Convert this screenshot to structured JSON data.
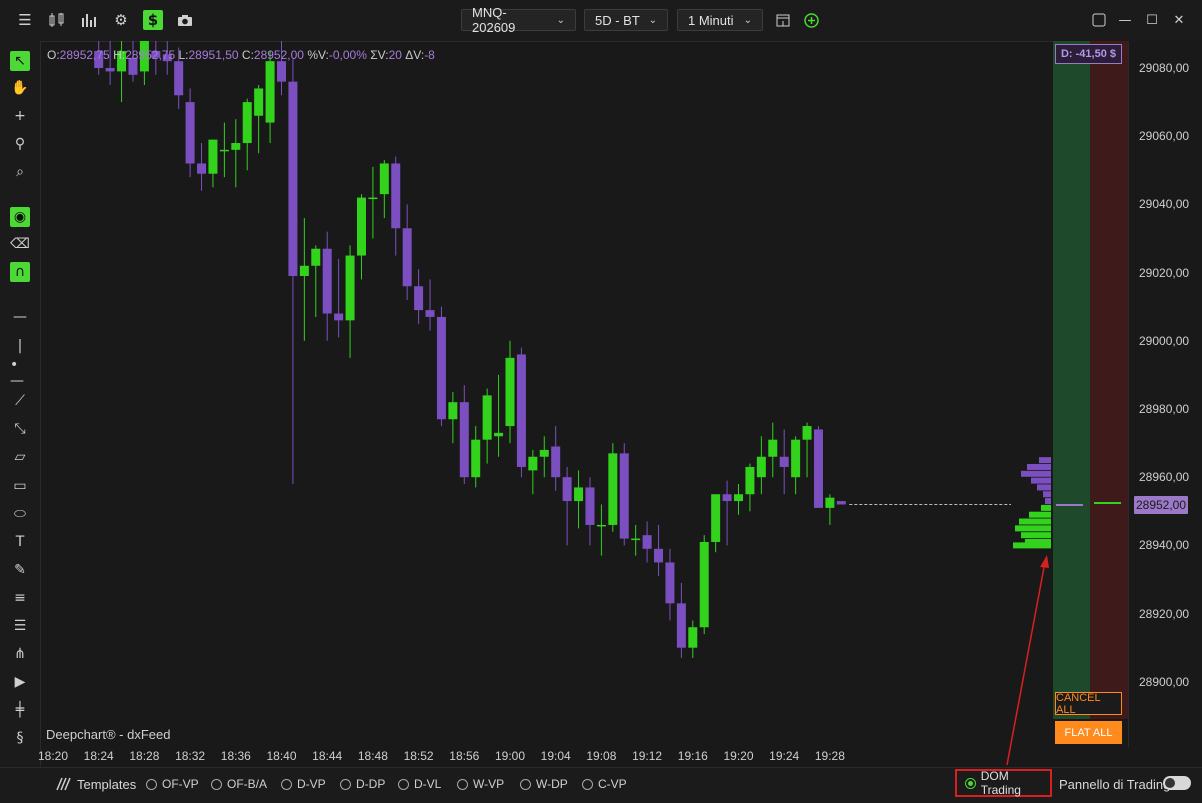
{
  "toolbar": {
    "icons": [
      "menu-icon",
      "bars-compare-icon",
      "bar-chart-icon",
      "settings-gear-icon",
      "dollar-icon",
      "camera-icon"
    ],
    "symbol": "MNQ-202609",
    "range": "5D - BT",
    "interval": "1 Minuti",
    "actions": [
      "layout-icon",
      "add-circle-icon"
    ],
    "window": [
      "restore-icon",
      "minimize-icon",
      "maximize-icon",
      "close-icon"
    ]
  },
  "left_tools": [
    "cursor-icon",
    "hand-icon",
    "crosshair-icon",
    "magnet-cursor-icon",
    "zoom-icon",
    "eye-icon",
    "eraser-icon",
    "magnet-icon",
    "horizontal-line-icon",
    "vertical-line-icon",
    "ray-icon",
    "trend-line-icon",
    "path-icon",
    "ruler-icon",
    "rectangle-icon",
    "ellipse-icon",
    "text-icon",
    "pencil-icon",
    "fib-icon",
    "list-icon",
    "pitchfork-icon",
    "arrow-icon",
    "volume-profile-icon",
    "settings-dollar-icon",
    "panel-toggle-icon"
  ],
  "ohlc": {
    "o_label": "O:",
    "o": "28952,75",
    "h_label": "H:",
    "h": "28952,75",
    "l_label": "L:",
    "l": "28951,50",
    "c_label": "C:",
    "c": "28952,00",
    "v_label": "%V:",
    "v": "-0,00%",
    "sv_label": "ΣV:",
    "sv": "20",
    "dv_label": "ΔV:",
    "dv": "-8"
  },
  "watermark": "Deepchart® - dxFeed",
  "price_axis": [
    "29080,00",
    "29060,00",
    "29040,00",
    "29020,00",
    "29000,00",
    "28980,00",
    "28960,00",
    "28940,00",
    "28920,00",
    "28900,00"
  ],
  "current_price": "28952,00",
  "time_axis": [
    "18:20",
    "18:24",
    "18:28",
    "18:32",
    "18:36",
    "18:40",
    "18:44",
    "18:48",
    "18:52",
    "18:56",
    "19:00",
    "19:04",
    "19:08",
    "19:12",
    "19:16",
    "19:20",
    "19:24",
    "19:28"
  ],
  "dom": {
    "pnl": "D: -41,50 $",
    "cancel_all": "CANCEL ALL",
    "flat_all": "FLAT ALL"
  },
  "bottom": {
    "templates_label": "Templates",
    "studies": [
      "OF-VP",
      "OF-B/A",
      "D-VP",
      "D-DP",
      "D-VL",
      "W-VP",
      "W-DP",
      "C-VP"
    ],
    "dom_trading": "DOM Trading",
    "trading_panel": "Pannello di Trading"
  },
  "colors": {
    "bull": "#33d21c",
    "bear": "#7b4fc0",
    "dom_buy": "#1e4a2b",
    "dom_sell": "#3e1a1b",
    "accent_orange": "#ff8a1e",
    "highlight_red": "#d82020"
  },
  "chart_data": {
    "type": "candlestick",
    "instrument": "MNQ-202609",
    "interval": "1 Minuti",
    "y_range": [
      28890,
      29090
    ],
    "candles": [
      {
        "t": "18:24",
        "o": 29085,
        "h": 29095,
        "l": 29078,
        "c": 29080
      },
      {
        "t": "18:25",
        "o": 29080,
        "h": 29088,
        "l": 29075,
        "c": 29079
      },
      {
        "t": "18:26",
        "o": 29079,
        "h": 29090,
        "l": 29070,
        "c": 29085
      },
      {
        "t": "18:27",
        "o": 29083,
        "h": 29092,
        "l": 29076,
        "c": 29078
      },
      {
        "t": "18:28",
        "o": 29079,
        "h": 29090,
        "l": 29075,
        "c": 29088
      },
      {
        "t": "18:29",
        "o": 29085,
        "h": 29094,
        "l": 29078,
        "c": 29083
      },
      {
        "t": "18:30",
        "o": 29084,
        "h": 29092,
        "l": 29078,
        "c": 29082
      },
      {
        "t": "18:31",
        "o": 29082,
        "h": 29086,
        "l": 29068,
        "c": 29072
      },
      {
        "t": "18:32",
        "o": 29070,
        "h": 29074,
        "l": 29048,
        "c": 29052
      },
      {
        "t": "18:33",
        "o": 29052,
        "h": 29058,
        "l": 29044,
        "c": 29049
      },
      {
        "t": "18:34",
        "o": 29049,
        "h": 29059,
        "l": 29045,
        "c": 29059
      },
      {
        "t": "18:35",
        "o": 29056,
        "h": 29064,
        "l": 29048,
        "c": 29056
      },
      {
        "t": "18:36",
        "o": 29056,
        "h": 29065,
        "l": 29045,
        "c": 29058
      },
      {
        "t": "18:37",
        "o": 29058,
        "h": 29071,
        "l": 29050,
        "c": 29070
      },
      {
        "t": "18:38",
        "o": 29066,
        "h": 29075,
        "l": 29055,
        "c": 29074
      },
      {
        "t": "18:39",
        "o": 29064,
        "h": 29085,
        "l": 29058,
        "c": 29082
      },
      {
        "t": "18:40",
        "o": 29082,
        "h": 29092,
        "l": 29072,
        "c": 29076
      },
      {
        "t": "18:41",
        "o": 29076,
        "h": 29083,
        "l": 28958,
        "c": 29019
      },
      {
        "t": "18:42",
        "o": 29019,
        "h": 29036,
        "l": 29000,
        "c": 29022
      },
      {
        "t": "18:43",
        "o": 29022,
        "h": 29028,
        "l": 29007,
        "c": 29027
      },
      {
        "t": "18:44",
        "o": 29027,
        "h": 29032,
        "l": 29000,
        "c": 29008
      },
      {
        "t": "18:45",
        "o": 29008,
        "h": 29024,
        "l": 29001,
        "c": 29006
      },
      {
        "t": "18:46",
        "o": 29006,
        "h": 29028,
        "l": 28995,
        "c": 29025
      },
      {
        "t": "18:47",
        "o": 29025,
        "h": 29043,
        "l": 29018,
        "c": 29042
      },
      {
        "t": "18:48",
        "o": 29042,
        "h": 29051,
        "l": 29030,
        "c": 29042
      },
      {
        "t": "18:49",
        "o": 29043,
        "h": 29053,
        "l": 29036,
        "c": 29052
      },
      {
        "t": "18:50",
        "o": 29052,
        "h": 29054,
        "l": 29025,
        "c": 29033
      },
      {
        "t": "18:51",
        "o": 29033,
        "h": 29040,
        "l": 29012,
        "c": 29016
      },
      {
        "t": "18:52",
        "o": 29016,
        "h": 29021,
        "l": 29005,
        "c": 29009
      },
      {
        "t": "18:53",
        "o": 29009,
        "h": 29018,
        "l": 29003,
        "c": 29007
      },
      {
        "t": "18:54",
        "o": 29007,
        "h": 29010,
        "l": 28975,
        "c": 28977
      },
      {
        "t": "18:55",
        "o": 28977,
        "h": 28985,
        "l": 28970,
        "c": 28982
      },
      {
        "t": "18:56",
        "o": 28982,
        "h": 28987,
        "l": 28958,
        "c": 28960
      },
      {
        "t": "18:57",
        "o": 28960,
        "h": 28975,
        "l": 28957,
        "c": 28971
      },
      {
        "t": "18:58",
        "o": 28971,
        "h": 28986,
        "l": 28964,
        "c": 28984
      },
      {
        "t": "18:59",
        "o": 28972,
        "h": 28990,
        "l": 28966,
        "c": 28973
      },
      {
        "t": "19:00",
        "o": 28975,
        "h": 29000,
        "l": 28970,
        "c": 28995
      },
      {
        "t": "19:01",
        "o": 28996,
        "h": 28998,
        "l": 28960,
        "c": 28963
      },
      {
        "t": "19:02",
        "o": 28962,
        "h": 28968,
        "l": 28955,
        "c": 28966
      },
      {
        "t": "19:03",
        "o": 28966,
        "h": 28972,
        "l": 28960,
        "c": 28968
      },
      {
        "t": "19:04",
        "o": 28969,
        "h": 28975,
        "l": 28956,
        "c": 28960
      },
      {
        "t": "19:05",
        "o": 28960,
        "h": 28963,
        "l": 28940,
        "c": 28953
      },
      {
        "t": "19:06",
        "o": 28953,
        "h": 28962,
        "l": 28945,
        "c": 28957
      },
      {
        "t": "19:07",
        "o": 28957,
        "h": 28960,
        "l": 28940,
        "c": 28946
      },
      {
        "t": "19:08",
        "o": 28946,
        "h": 28952,
        "l": 28937,
        "c": 28946
      },
      {
        "t": "19:09",
        "o": 28946,
        "h": 28970,
        "l": 28944,
        "c": 28967
      },
      {
        "t": "19:10",
        "o": 28967,
        "h": 28970,
        "l": 28940,
        "c": 28942
      },
      {
        "t": "19:11",
        "o": 28942,
        "h": 28946,
        "l": 28937,
        "c": 28942
      },
      {
        "t": "19:12",
        "o": 28943,
        "h": 28947,
        "l": 28935,
        "c": 28939
      },
      {
        "t": "19:13",
        "o": 28939,
        "h": 28946,
        "l": 28931,
        "c": 28935
      },
      {
        "t": "19:14",
        "o": 28935,
        "h": 28939,
        "l": 28918,
        "c": 28923
      },
      {
        "t": "19:15",
        "o": 28923,
        "h": 28929,
        "l": 28907,
        "c": 28910
      },
      {
        "t": "19:16",
        "o": 28910,
        "h": 28918,
        "l": 28907,
        "c": 28916
      },
      {
        "t": "19:17",
        "o": 28916,
        "h": 28943,
        "l": 28914,
        "c": 28941
      },
      {
        "t": "19:18",
        "o": 28941,
        "h": 28955,
        "l": 28938,
        "c": 28955
      },
      {
        "t": "19:19",
        "o": 28955,
        "h": 28959,
        "l": 28940,
        "c": 28953
      },
      {
        "t": "19:20",
        "o": 28953,
        "h": 28958,
        "l": 28949,
        "c": 28955
      },
      {
        "t": "19:21",
        "o": 28955,
        "h": 28964,
        "l": 28950,
        "c": 28963
      },
      {
        "t": "19:22",
        "o": 28960,
        "h": 28972,
        "l": 28955,
        "c": 28966
      },
      {
        "t": "19:23",
        "o": 28966,
        "h": 28976,
        "l": 28960,
        "c": 28971
      },
      {
        "t": "19:24",
        "o": 28966,
        "h": 28974,
        "l": 28955,
        "c": 28963
      },
      {
        "t": "19:25",
        "o": 28960,
        "h": 28972,
        "l": 28955,
        "c": 28971
      },
      {
        "t": "19:26",
        "o": 28971,
        "h": 28976,
        "l": 28960,
        "c": 28975
      },
      {
        "t": "19:27",
        "o": 28974,
        "h": 28975,
        "l": 28951,
        "c": 28951
      },
      {
        "t": "19:28",
        "o": 28951,
        "h": 28955,
        "l": 28946,
        "c": 28954
      },
      {
        "t": "19:29",
        "o": 28953,
        "h": 28953,
        "l": 28952,
        "c": 28952
      }
    ]
  }
}
